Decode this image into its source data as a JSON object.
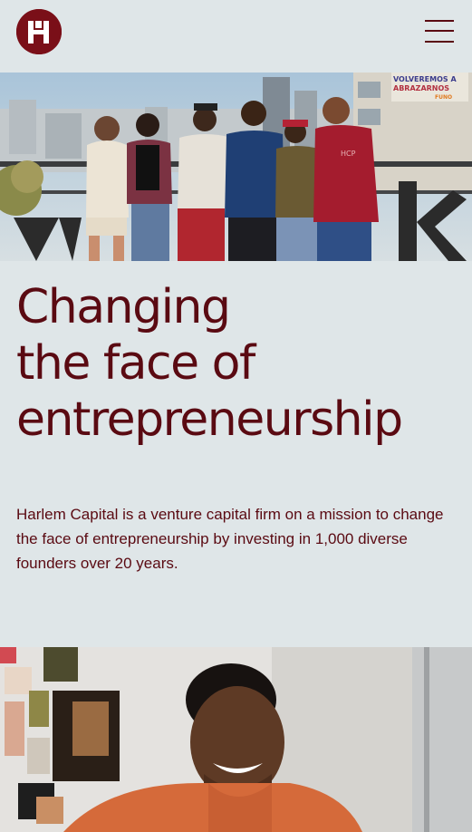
{
  "header": {
    "logo_alt": "H",
    "menu_label": "Menu"
  },
  "hero": {
    "sign_text_line1": "VOLVEREMOS A",
    "sign_text_line2": "ABRAZARNOS",
    "sign_text_line3": "FUNO",
    "shirt_text": "HCP"
  },
  "headline": {
    "line1": "Changing",
    "line2": "the face of",
    "line3": "entrepreneurship"
  },
  "description": {
    "text": "Harlem Capital is a venture capital firm on a mission to change the face of entrepreneurship by investing in 1,000 diverse founders over 20 years."
  },
  "colors": {
    "background": "#dfe6e8",
    "brand": "#7a0f18",
    "text": "#5a0a12"
  },
  "icons": {
    "logo": "harlem-capital-logo-icon",
    "menu": "hamburger-menu-icon"
  }
}
